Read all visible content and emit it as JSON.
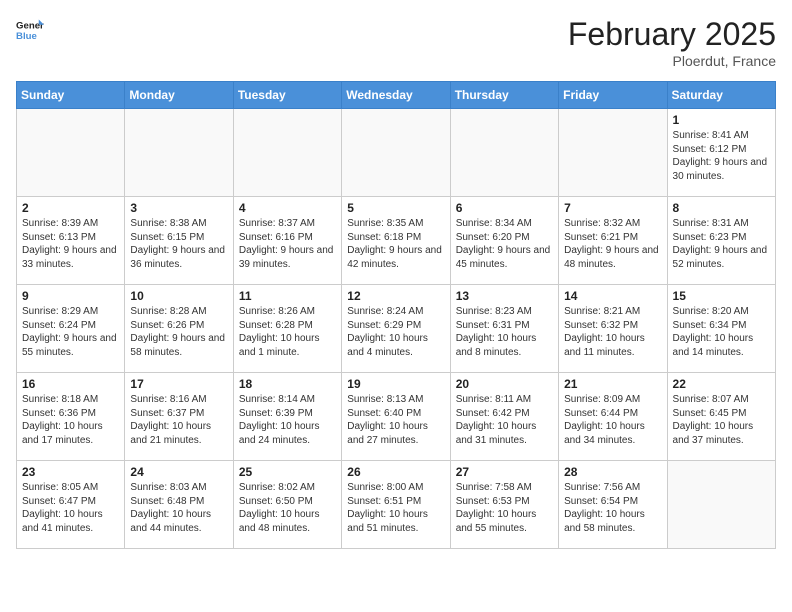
{
  "header": {
    "logo_general": "General",
    "logo_blue": "Blue",
    "month_title": "February 2025",
    "location": "Ploerdut, France"
  },
  "weekdays": [
    "Sunday",
    "Monday",
    "Tuesday",
    "Wednesday",
    "Thursday",
    "Friday",
    "Saturday"
  ],
  "weeks": [
    [
      {
        "day": "",
        "info": ""
      },
      {
        "day": "",
        "info": ""
      },
      {
        "day": "",
        "info": ""
      },
      {
        "day": "",
        "info": ""
      },
      {
        "day": "",
        "info": ""
      },
      {
        "day": "",
        "info": ""
      },
      {
        "day": "1",
        "info": "Sunrise: 8:41 AM\nSunset: 6:12 PM\nDaylight: 9 hours and 30 minutes."
      }
    ],
    [
      {
        "day": "2",
        "info": "Sunrise: 8:39 AM\nSunset: 6:13 PM\nDaylight: 9 hours and 33 minutes."
      },
      {
        "day": "3",
        "info": "Sunrise: 8:38 AM\nSunset: 6:15 PM\nDaylight: 9 hours and 36 minutes."
      },
      {
        "day": "4",
        "info": "Sunrise: 8:37 AM\nSunset: 6:16 PM\nDaylight: 9 hours and 39 minutes."
      },
      {
        "day": "5",
        "info": "Sunrise: 8:35 AM\nSunset: 6:18 PM\nDaylight: 9 hours and 42 minutes."
      },
      {
        "day": "6",
        "info": "Sunrise: 8:34 AM\nSunset: 6:20 PM\nDaylight: 9 hours and 45 minutes."
      },
      {
        "day": "7",
        "info": "Sunrise: 8:32 AM\nSunset: 6:21 PM\nDaylight: 9 hours and 48 minutes."
      },
      {
        "day": "8",
        "info": "Sunrise: 8:31 AM\nSunset: 6:23 PM\nDaylight: 9 hours and 52 minutes."
      }
    ],
    [
      {
        "day": "9",
        "info": "Sunrise: 8:29 AM\nSunset: 6:24 PM\nDaylight: 9 hours and 55 minutes."
      },
      {
        "day": "10",
        "info": "Sunrise: 8:28 AM\nSunset: 6:26 PM\nDaylight: 9 hours and 58 minutes."
      },
      {
        "day": "11",
        "info": "Sunrise: 8:26 AM\nSunset: 6:28 PM\nDaylight: 10 hours and 1 minute."
      },
      {
        "day": "12",
        "info": "Sunrise: 8:24 AM\nSunset: 6:29 PM\nDaylight: 10 hours and 4 minutes."
      },
      {
        "day": "13",
        "info": "Sunrise: 8:23 AM\nSunset: 6:31 PM\nDaylight: 10 hours and 8 minutes."
      },
      {
        "day": "14",
        "info": "Sunrise: 8:21 AM\nSunset: 6:32 PM\nDaylight: 10 hours and 11 minutes."
      },
      {
        "day": "15",
        "info": "Sunrise: 8:20 AM\nSunset: 6:34 PM\nDaylight: 10 hours and 14 minutes."
      }
    ],
    [
      {
        "day": "16",
        "info": "Sunrise: 8:18 AM\nSunset: 6:36 PM\nDaylight: 10 hours and 17 minutes."
      },
      {
        "day": "17",
        "info": "Sunrise: 8:16 AM\nSunset: 6:37 PM\nDaylight: 10 hours and 21 minutes."
      },
      {
        "day": "18",
        "info": "Sunrise: 8:14 AM\nSunset: 6:39 PM\nDaylight: 10 hours and 24 minutes."
      },
      {
        "day": "19",
        "info": "Sunrise: 8:13 AM\nSunset: 6:40 PM\nDaylight: 10 hours and 27 minutes."
      },
      {
        "day": "20",
        "info": "Sunrise: 8:11 AM\nSunset: 6:42 PM\nDaylight: 10 hours and 31 minutes."
      },
      {
        "day": "21",
        "info": "Sunrise: 8:09 AM\nSunset: 6:44 PM\nDaylight: 10 hours and 34 minutes."
      },
      {
        "day": "22",
        "info": "Sunrise: 8:07 AM\nSunset: 6:45 PM\nDaylight: 10 hours and 37 minutes."
      }
    ],
    [
      {
        "day": "23",
        "info": "Sunrise: 8:05 AM\nSunset: 6:47 PM\nDaylight: 10 hours and 41 minutes."
      },
      {
        "day": "24",
        "info": "Sunrise: 8:03 AM\nSunset: 6:48 PM\nDaylight: 10 hours and 44 minutes."
      },
      {
        "day": "25",
        "info": "Sunrise: 8:02 AM\nSunset: 6:50 PM\nDaylight: 10 hours and 48 minutes."
      },
      {
        "day": "26",
        "info": "Sunrise: 8:00 AM\nSunset: 6:51 PM\nDaylight: 10 hours and 51 minutes."
      },
      {
        "day": "27",
        "info": "Sunrise: 7:58 AM\nSunset: 6:53 PM\nDaylight: 10 hours and 55 minutes."
      },
      {
        "day": "28",
        "info": "Sunrise: 7:56 AM\nSunset: 6:54 PM\nDaylight: 10 hours and 58 minutes."
      },
      {
        "day": "",
        "info": ""
      }
    ]
  ]
}
